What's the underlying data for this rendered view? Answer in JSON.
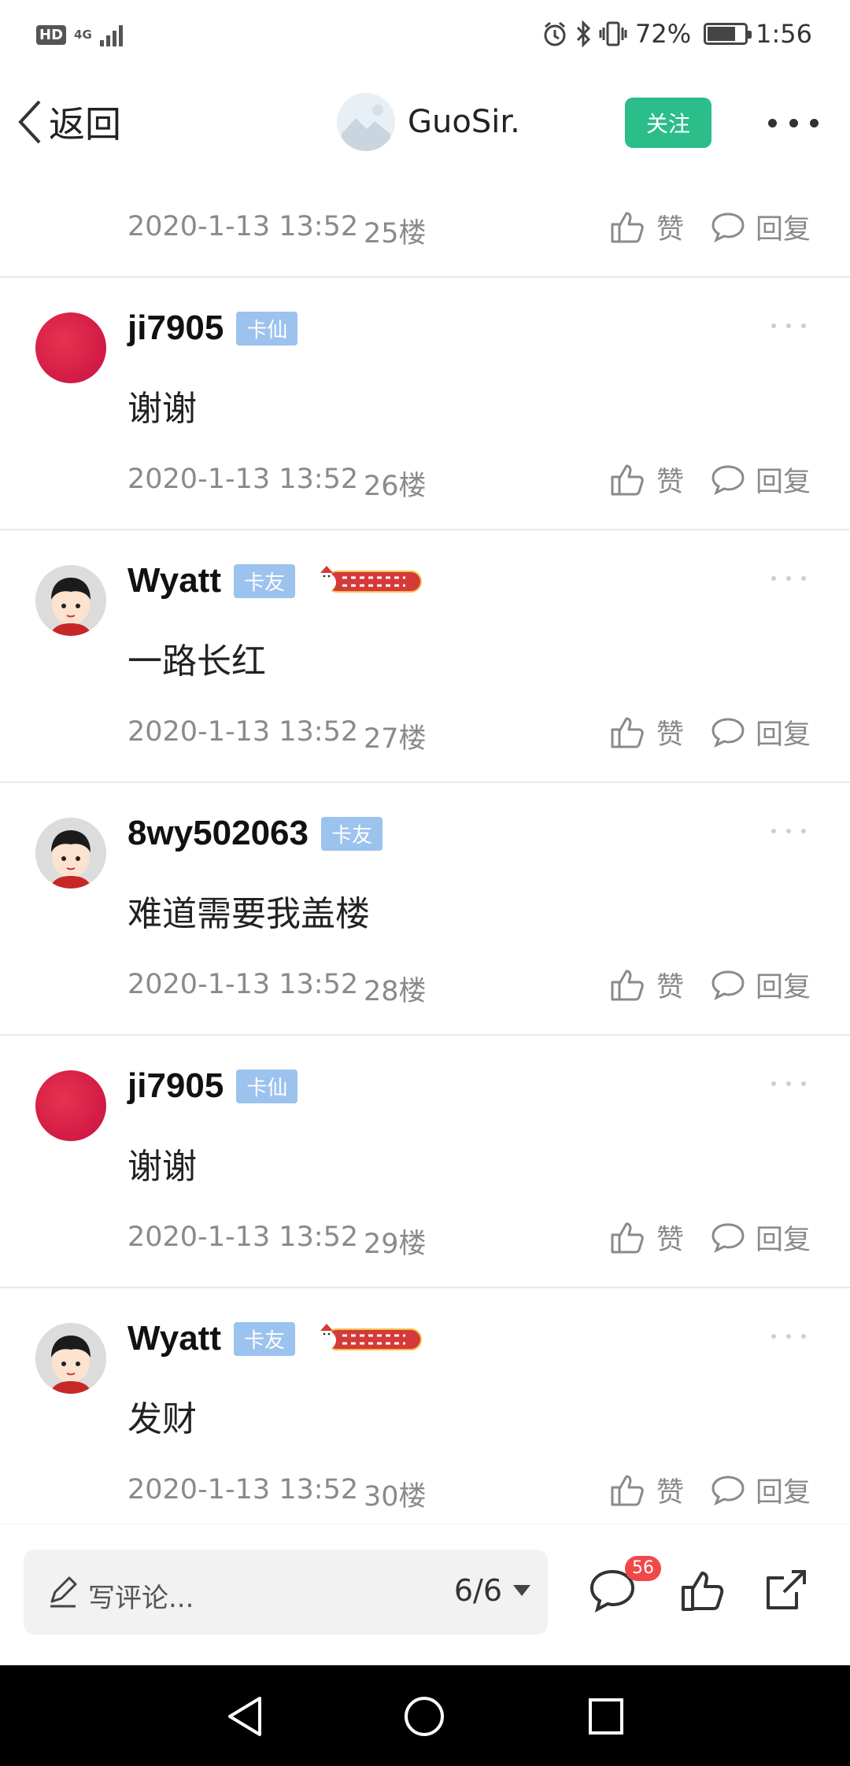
{
  "status_bar": {
    "hd_label": "HD",
    "network_label": "4G",
    "battery": "72%",
    "battery_level": 0.72,
    "time": "1:56",
    "icons": [
      "hd-icon",
      "signal-icon",
      "alarm-icon",
      "bluetooth-icon",
      "vibrate-icon",
      "battery-icon"
    ]
  },
  "header": {
    "back_label": "返回",
    "author_name": "GuoSir.",
    "follow_label": "关注",
    "accent_color": "#2bbd8a"
  },
  "floors": [
    {
      "partial": true,
      "time": "2020-1-13 13:52",
      "floor": "25楼",
      "like_label": "赞",
      "reply_label": "回复"
    },
    {
      "user": "ji7905",
      "tag": "卡仙",
      "avatar": "red-circle",
      "content": "谢谢",
      "time": "2020-1-13 13:52",
      "floor": "26楼",
      "like_label": "赞",
      "reply_label": "回复"
    },
    {
      "user": "Wyatt",
      "tag": "卡友",
      "badge": "christmas-badge",
      "avatar": "cartoon-face",
      "content": "一路长红",
      "time": "2020-1-13 13:52",
      "floor": "27楼",
      "like_label": "赞",
      "reply_label": "回复"
    },
    {
      "user": "8wy502063",
      "tag": "卡友",
      "avatar": "cartoon-face",
      "content": "难道需要我盖楼",
      "time": "2020-1-13 13:52",
      "floor": "28楼",
      "like_label": "赞",
      "reply_label": "回复"
    },
    {
      "user": "ji7905",
      "tag": "卡仙",
      "avatar": "red-circle",
      "content": "谢谢",
      "time": "2020-1-13 13:52",
      "floor": "29楼",
      "like_label": "赞",
      "reply_label": "回复"
    },
    {
      "user": "Wyatt",
      "tag": "卡友",
      "badge": "christmas-badge",
      "avatar": "cartoon-face",
      "content": "发财",
      "time": "2020-1-13 13:52",
      "floor": "30楼",
      "like_label": "赞",
      "reply_label": "回复"
    }
  ],
  "bottom_bar": {
    "comment_placeholder": "写评论...",
    "page_indicator": "6/6",
    "comment_count": "56",
    "icons": [
      "pen-icon",
      "dropdown-triangle-icon",
      "comment-icon",
      "thumbs-up-icon",
      "share-icon"
    ]
  },
  "nav_bar": {
    "icons": [
      "back-triangle-icon",
      "home-circle-icon",
      "recents-square-icon"
    ]
  }
}
